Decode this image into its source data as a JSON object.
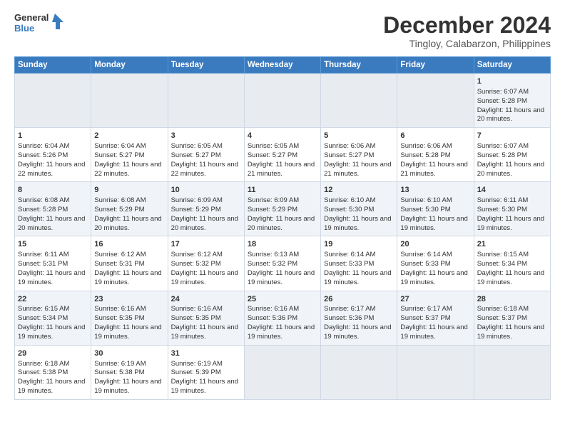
{
  "header": {
    "logo_line1": "General",
    "logo_line2": "Blue",
    "title": "December 2024",
    "subtitle": "Tingloy, Calabarzon, Philippines"
  },
  "calendar": {
    "days_of_week": [
      "Sunday",
      "Monday",
      "Tuesday",
      "Wednesday",
      "Thursday",
      "Friday",
      "Saturday"
    ],
    "weeks": [
      [
        {
          "day": "",
          "empty": true
        },
        {
          "day": "",
          "empty": true
        },
        {
          "day": "",
          "empty": true
        },
        {
          "day": "",
          "empty": true
        },
        {
          "day": "",
          "empty": true
        },
        {
          "day": "",
          "empty": true
        },
        {
          "day": "1",
          "sunrise": "Sunrise: 6:07 AM",
          "sunset": "Sunset: 5:28 PM",
          "daylight": "Daylight: 11 hours and 20 minutes."
        }
      ],
      [
        {
          "day": "1",
          "sunrise": "Sunrise: 6:04 AM",
          "sunset": "Sunset: 5:26 PM",
          "daylight": "Daylight: 11 hours and 22 minutes."
        },
        {
          "day": "2",
          "sunrise": "Sunrise: 6:04 AM",
          "sunset": "Sunset: 5:27 PM",
          "daylight": "Daylight: 11 hours and 22 minutes."
        },
        {
          "day": "3",
          "sunrise": "Sunrise: 6:05 AM",
          "sunset": "Sunset: 5:27 PM",
          "daylight": "Daylight: 11 hours and 22 minutes."
        },
        {
          "day": "4",
          "sunrise": "Sunrise: 6:05 AM",
          "sunset": "Sunset: 5:27 PM",
          "daylight": "Daylight: 11 hours and 21 minutes."
        },
        {
          "day": "5",
          "sunrise": "Sunrise: 6:06 AM",
          "sunset": "Sunset: 5:27 PM",
          "daylight": "Daylight: 11 hours and 21 minutes."
        },
        {
          "day": "6",
          "sunrise": "Sunrise: 6:06 AM",
          "sunset": "Sunset: 5:28 PM",
          "daylight": "Daylight: 11 hours and 21 minutes."
        },
        {
          "day": "7",
          "sunrise": "Sunrise: 6:07 AM",
          "sunset": "Sunset: 5:28 PM",
          "daylight": "Daylight: 11 hours and 20 minutes."
        }
      ],
      [
        {
          "day": "8",
          "sunrise": "Sunrise: 6:08 AM",
          "sunset": "Sunset: 5:28 PM",
          "daylight": "Daylight: 11 hours and 20 minutes."
        },
        {
          "day": "9",
          "sunrise": "Sunrise: 6:08 AM",
          "sunset": "Sunset: 5:29 PM",
          "daylight": "Daylight: 11 hours and 20 minutes."
        },
        {
          "day": "10",
          "sunrise": "Sunrise: 6:09 AM",
          "sunset": "Sunset: 5:29 PM",
          "daylight": "Daylight: 11 hours and 20 minutes."
        },
        {
          "day": "11",
          "sunrise": "Sunrise: 6:09 AM",
          "sunset": "Sunset: 5:29 PM",
          "daylight": "Daylight: 11 hours and 20 minutes."
        },
        {
          "day": "12",
          "sunrise": "Sunrise: 6:10 AM",
          "sunset": "Sunset: 5:30 PM",
          "daylight": "Daylight: 11 hours and 19 minutes."
        },
        {
          "day": "13",
          "sunrise": "Sunrise: 6:10 AM",
          "sunset": "Sunset: 5:30 PM",
          "daylight": "Daylight: 11 hours and 19 minutes."
        },
        {
          "day": "14",
          "sunrise": "Sunrise: 6:11 AM",
          "sunset": "Sunset: 5:30 PM",
          "daylight": "Daylight: 11 hours and 19 minutes."
        }
      ],
      [
        {
          "day": "15",
          "sunrise": "Sunrise: 6:11 AM",
          "sunset": "Sunset: 5:31 PM",
          "daylight": "Daylight: 11 hours and 19 minutes."
        },
        {
          "day": "16",
          "sunrise": "Sunrise: 6:12 AM",
          "sunset": "Sunset: 5:31 PM",
          "daylight": "Daylight: 11 hours and 19 minutes."
        },
        {
          "day": "17",
          "sunrise": "Sunrise: 6:12 AM",
          "sunset": "Sunset: 5:32 PM",
          "daylight": "Daylight: 11 hours and 19 minutes."
        },
        {
          "day": "18",
          "sunrise": "Sunrise: 6:13 AM",
          "sunset": "Sunset: 5:32 PM",
          "daylight": "Daylight: 11 hours and 19 minutes."
        },
        {
          "day": "19",
          "sunrise": "Sunrise: 6:14 AM",
          "sunset": "Sunset: 5:33 PM",
          "daylight": "Daylight: 11 hours and 19 minutes."
        },
        {
          "day": "20",
          "sunrise": "Sunrise: 6:14 AM",
          "sunset": "Sunset: 5:33 PM",
          "daylight": "Daylight: 11 hours and 19 minutes."
        },
        {
          "day": "21",
          "sunrise": "Sunrise: 6:15 AM",
          "sunset": "Sunset: 5:34 PM",
          "daylight": "Daylight: 11 hours and 19 minutes."
        }
      ],
      [
        {
          "day": "22",
          "sunrise": "Sunrise: 6:15 AM",
          "sunset": "Sunset: 5:34 PM",
          "daylight": "Daylight: 11 hours and 19 minutes."
        },
        {
          "day": "23",
          "sunrise": "Sunrise: 6:16 AM",
          "sunset": "Sunset: 5:35 PM",
          "daylight": "Daylight: 11 hours and 19 minutes."
        },
        {
          "day": "24",
          "sunrise": "Sunrise: 6:16 AM",
          "sunset": "Sunset: 5:35 PM",
          "daylight": "Daylight: 11 hours and 19 minutes."
        },
        {
          "day": "25",
          "sunrise": "Sunrise: 6:16 AM",
          "sunset": "Sunset: 5:36 PM",
          "daylight": "Daylight: 11 hours and 19 minutes."
        },
        {
          "day": "26",
          "sunrise": "Sunrise: 6:17 AM",
          "sunset": "Sunset: 5:36 PM",
          "daylight": "Daylight: 11 hours and 19 minutes."
        },
        {
          "day": "27",
          "sunrise": "Sunrise: 6:17 AM",
          "sunset": "Sunset: 5:37 PM",
          "daylight": "Daylight: 11 hours and 19 minutes."
        },
        {
          "day": "28",
          "sunrise": "Sunrise: 6:18 AM",
          "sunset": "Sunset: 5:37 PM",
          "daylight": "Daylight: 11 hours and 19 minutes."
        }
      ],
      [
        {
          "day": "29",
          "sunrise": "Sunrise: 6:18 AM",
          "sunset": "Sunset: 5:38 PM",
          "daylight": "Daylight: 11 hours and 19 minutes."
        },
        {
          "day": "30",
          "sunrise": "Sunrise: 6:19 AM",
          "sunset": "Sunset: 5:38 PM",
          "daylight": "Daylight: 11 hours and 19 minutes."
        },
        {
          "day": "31",
          "sunrise": "Sunrise: 6:19 AM",
          "sunset": "Sunset: 5:39 PM",
          "daylight": "Daylight: 11 hours and 19 minutes."
        },
        {
          "day": "",
          "empty": true
        },
        {
          "day": "",
          "empty": true
        },
        {
          "day": "",
          "empty": true
        },
        {
          "day": "",
          "empty": true
        }
      ]
    ]
  }
}
